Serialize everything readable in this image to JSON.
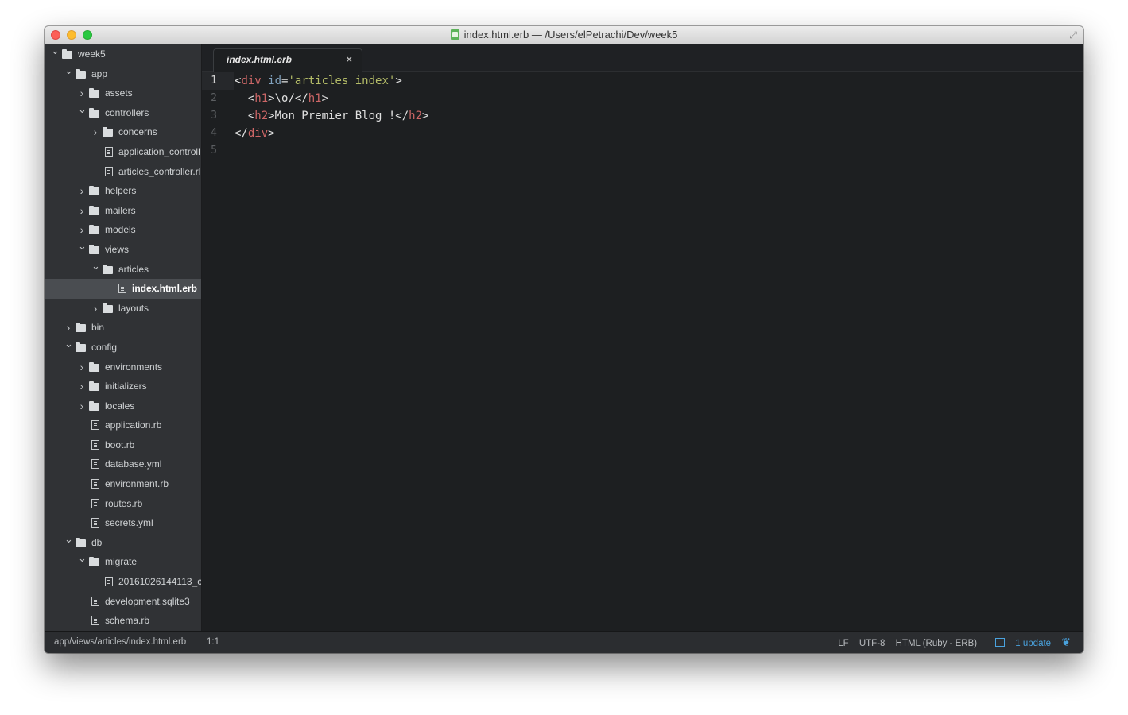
{
  "window": {
    "title": "index.html.erb — /Users/elPetrachi/Dev/week5"
  },
  "tree": [
    {
      "label": "week5",
      "type": "folder",
      "depth": 0,
      "expanded": true
    },
    {
      "label": "app",
      "type": "folder",
      "depth": 1,
      "expanded": true
    },
    {
      "label": "assets",
      "type": "folder",
      "depth": 2,
      "expanded": false
    },
    {
      "label": "controllers",
      "type": "folder",
      "depth": 2,
      "expanded": true
    },
    {
      "label": "concerns",
      "type": "folder",
      "depth": 3,
      "expanded": false
    },
    {
      "label": "application_controll",
      "type": "file",
      "depth": 3
    },
    {
      "label": "articles_controller.rl",
      "type": "file",
      "depth": 3
    },
    {
      "label": "helpers",
      "type": "folder",
      "depth": 2,
      "expanded": false
    },
    {
      "label": "mailers",
      "type": "folder",
      "depth": 2,
      "expanded": false
    },
    {
      "label": "models",
      "type": "folder",
      "depth": 2,
      "expanded": false
    },
    {
      "label": "views",
      "type": "folder",
      "depth": 2,
      "expanded": true
    },
    {
      "label": "articles",
      "type": "folder",
      "depth": 3,
      "expanded": true
    },
    {
      "label": "index.html.erb",
      "type": "file",
      "depth": 4,
      "selected": true
    },
    {
      "label": "layouts",
      "type": "folder",
      "depth": 3,
      "expanded": false
    },
    {
      "label": "bin",
      "type": "folder",
      "depth": 1,
      "expanded": false
    },
    {
      "label": "config",
      "type": "folder",
      "depth": 1,
      "expanded": true
    },
    {
      "label": "environments",
      "type": "folder",
      "depth": 2,
      "expanded": false
    },
    {
      "label": "initializers",
      "type": "folder",
      "depth": 2,
      "expanded": false
    },
    {
      "label": "locales",
      "type": "folder",
      "depth": 2,
      "expanded": false
    },
    {
      "label": "application.rb",
      "type": "file",
      "depth": 2
    },
    {
      "label": "boot.rb",
      "type": "file",
      "depth": 2
    },
    {
      "label": "database.yml",
      "type": "file",
      "depth": 2
    },
    {
      "label": "environment.rb",
      "type": "file",
      "depth": 2
    },
    {
      "label": "routes.rb",
      "type": "file",
      "depth": 2
    },
    {
      "label": "secrets.yml",
      "type": "file",
      "depth": 2
    },
    {
      "label": "db",
      "type": "folder",
      "depth": 1,
      "expanded": true
    },
    {
      "label": "migrate",
      "type": "folder",
      "depth": 2,
      "expanded": true
    },
    {
      "label": "20161026144113_c",
      "type": "file",
      "depth": 3
    },
    {
      "label": "development.sqlite3",
      "type": "file",
      "depth": 2
    },
    {
      "label": "schema.rb",
      "type": "file",
      "depth": 2
    }
  ],
  "tab": {
    "label": "index.html.erb",
    "close_glyph": "×"
  },
  "editor": {
    "line_numbers": [
      "1",
      "2",
      "3",
      "4",
      "5"
    ],
    "active_line": 1,
    "lines": [
      [
        {
          "t": "<",
          "c": "pn"
        },
        {
          "t": "div",
          "c": "tg"
        },
        {
          "t": " ",
          "c": "pn"
        },
        {
          "t": "id",
          "c": "at"
        },
        {
          "t": "=",
          "c": "pn"
        },
        {
          "t": "'articles_index'",
          "c": "st"
        },
        {
          "t": ">",
          "c": "pn"
        }
      ],
      [
        {
          "t": "  <",
          "c": "pn"
        },
        {
          "t": "h1",
          "c": "tg"
        },
        {
          "t": ">\\o/</",
          "c": "pn"
        },
        {
          "t": "h1",
          "c": "tg"
        },
        {
          "t": ">",
          "c": "pn"
        }
      ],
      [
        {
          "t": "  <",
          "c": "pn"
        },
        {
          "t": "h2",
          "c": "tg"
        },
        {
          "t": ">Mon Premier Blog !</",
          "c": "pn"
        },
        {
          "t": "h2",
          "c": "tg"
        },
        {
          "t": ">",
          "c": "pn"
        }
      ],
      [
        {
          "t": "</",
          "c": "pn"
        },
        {
          "t": "div",
          "c": "tg"
        },
        {
          "t": ">",
          "c": "pn"
        }
      ],
      []
    ]
  },
  "status": {
    "path": "app/views/articles/index.html.erb",
    "cursor": "1:1",
    "line_ending": "LF",
    "encoding": "UTF-8",
    "grammar": "HTML (Ruby - ERB)",
    "update": "1 update"
  },
  "colors": {
    "editor_bg": "#1d1f21",
    "sidebar_bg": "#303235",
    "tag": "#cc6666",
    "attr": "#81a2be",
    "string": "#b5bd68",
    "accent": "#4aa3df"
  }
}
